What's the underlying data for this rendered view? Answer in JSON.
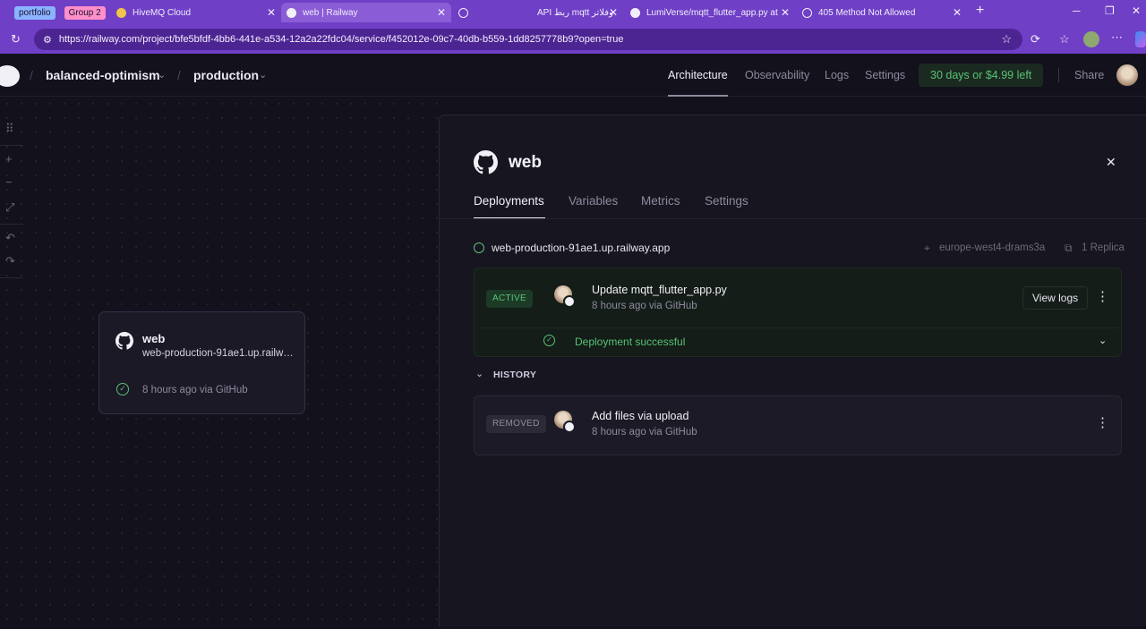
{
  "browser": {
    "tab_groups": [
      {
        "label": "portfolio",
        "color": "#8ab4ff"
      },
      {
        "label": "Group 2",
        "color": "#ff8fc8"
      }
    ],
    "tabs": [
      {
        "title": "HiveMQ Cloud"
      },
      {
        "title": "web | Railway"
      },
      {
        "title": "API ربط mqtt وفلاتر"
      },
      {
        "title": "LumiVerse/mqtt_flutter_app.py at"
      },
      {
        "title": "405 Method Not Allowed"
      }
    ],
    "url": "https://railway.com/project/bfe5bfdf-4bb6-441e-a534-12a2a22fdc04/service/f452012e-09c7-40db-b559-1dd8257778b9?open=true"
  },
  "header": {
    "project": "balanced-optimism",
    "environment": "production",
    "nav": [
      "Architecture",
      "Observability",
      "Logs",
      "Settings"
    ],
    "trial": "30 days or $4.99 left",
    "share": "Share"
  },
  "canvas": {
    "service": {
      "name": "web",
      "url": "web-production-91ae1.up.railway.app",
      "status": "8 hours ago via GitHub"
    }
  },
  "panel": {
    "title": "web",
    "tabs": [
      "Deployments",
      "Variables",
      "Metrics",
      "Settings"
    ],
    "domain": "web-production-91ae1.up.railway.app",
    "region": "europe-west4-drams3a",
    "replicas": "1 Replica",
    "active_deployment": {
      "badge": "ACTIVE",
      "title": "Update mqtt_flutter_app.py",
      "subtitle": "8 hours ago via GitHub",
      "view_logs": "View logs",
      "status": "Deployment successful"
    },
    "history_label": "HISTORY",
    "history": [
      {
        "badge": "REMOVED",
        "title": "Add files via upload",
        "subtitle": "8 hours ago via GitHub"
      }
    ]
  },
  "colors": {
    "browser_accent": "#6f3fc6",
    "success": "#57c276",
    "background": "#13111c"
  }
}
